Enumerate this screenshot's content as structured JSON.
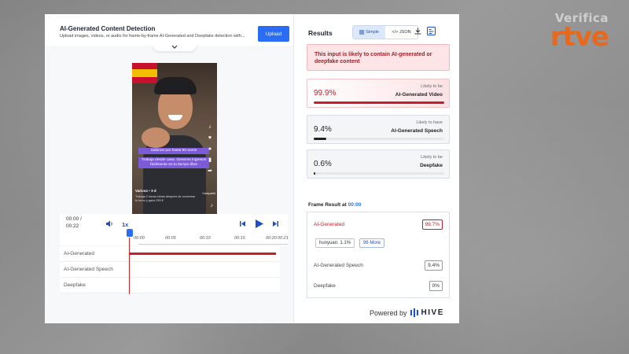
{
  "branding": {
    "verifica": "Verifica",
    "rtve": "rtve"
  },
  "header": {
    "title": "AI-Generated Content Detection",
    "subtitle": "Upload images, videos, or audio for frame-by-frame AI-Generated and Deepfake detection with...",
    "upload_label": "Upload"
  },
  "video": {
    "caption1": "Salarios por hasta 90 euros",
    "caption2": "Trabaja desde casa. Generes ingresos fácilmente en tu tiempo libre",
    "username": "Varicos • 3 d",
    "description": "Trabaja 2 horas extras después de conversar tu turno y gana 250 €",
    "share_label": "Compartir"
  },
  "player": {
    "current_time": "00:00 /",
    "total_time": "00:22",
    "speed": "1x",
    "ticks": [
      "00:00",
      "00:05",
      "00:10",
      "00:15",
      "00:20",
      "00:21"
    ]
  },
  "tracks": [
    {
      "label": "AI-Generated",
      "fill": 0.98
    },
    {
      "label": "AI-Generated Speech",
      "fill": 0
    },
    {
      "label": "Deepfake",
      "fill": 0
    }
  ],
  "results": {
    "title": "Results",
    "toggle_simple": "Simple",
    "toggle_json": "</> JSON",
    "alert_prefix": "This input is ",
    "alert_emphasis": "likely to contain AI-generated or deepfake content",
    "cards": [
      {
        "pct": "99.9%",
        "sub": "Likely to be",
        "label": "AI-Generated Video",
        "fill": 0.999
      },
      {
        "pct": "9.4%",
        "sub": "Likely to have",
        "label": "AI-Generated Speech",
        "fill": 0.094
      },
      {
        "pct": "0.6%",
        "sub": "Likely to be",
        "label": "Deepfake",
        "fill": 0.006
      }
    ],
    "frame_title": "Frame Result at ",
    "frame_time": "00:00",
    "frame": {
      "ai_label": "AI-Generated",
      "ai_value": "99.7%",
      "chip_model": "hunyuan: 1.1%",
      "chip_more": "96 More",
      "speech_label": "AI-Generated Speech",
      "speech_value": "9.4%",
      "deepfake_label": "Deepfake",
      "deepfake_value": "0%"
    },
    "powered_by": "Powered by",
    "hive": "HIVE"
  },
  "colors": {
    "accent": "#2a6df4",
    "danger": "#c81e2b",
    "brand_orange": "#e8681c"
  }
}
